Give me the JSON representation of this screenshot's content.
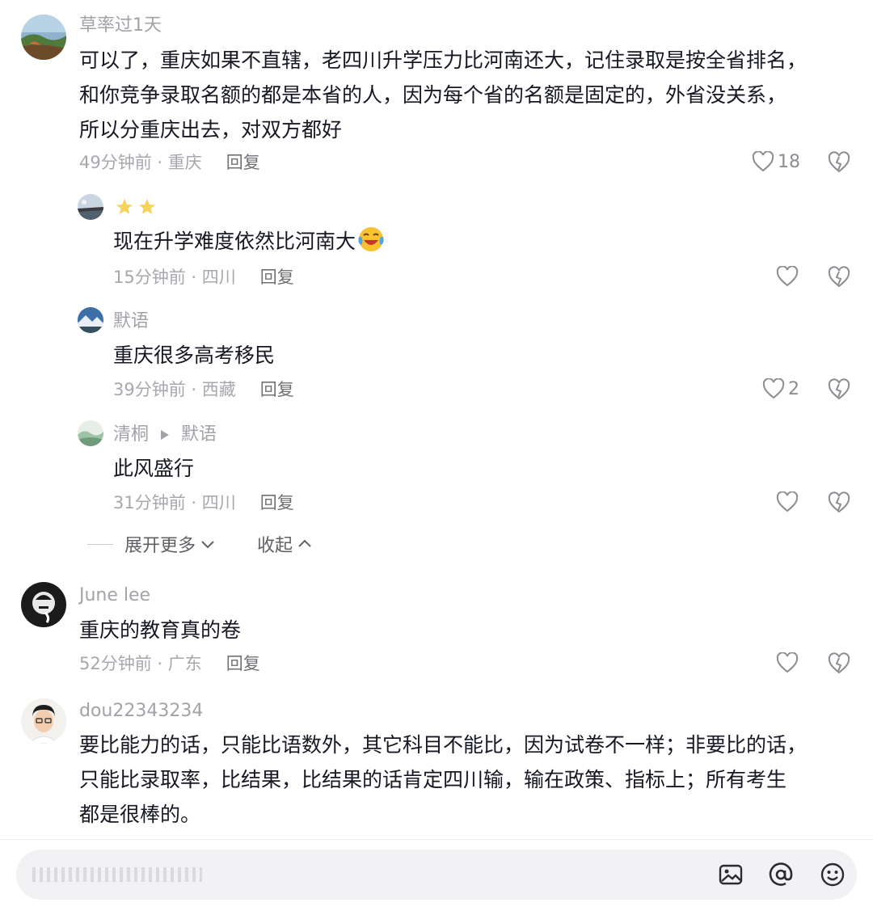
{
  "comments": [
    {
      "username": "草率过1天",
      "lines": [
        "可以了，重庆如果不直辖，老四川升学压力比河南还大，记住录取是按全省排名，",
        "和你竞争录取名额的都是本省的人，因为每个省的名额是固定的，外省没关系，",
        "所以分重庆出去，对双方都好"
      ],
      "time": "49分钟前 · 重庆",
      "reply_label": "回复",
      "like_count": "18"
    },
    {
      "username": "",
      "text": "现在升学难度依然比河南大",
      "time": "15分钟前 · 四川",
      "reply_label": "回复",
      "like_count": ""
    },
    {
      "username": "默语",
      "text": "重庆很多高考移民",
      "time": "39分钟前 · 西藏",
      "reply_label": "回复",
      "like_count": "2"
    },
    {
      "username": "清桐",
      "reply_to": "默语",
      "text": "此风盛行",
      "time": "31分钟前 · 四川",
      "reply_label": "回复",
      "like_count": ""
    },
    {
      "username": "June lee",
      "text": "重庆的教育真的卷",
      "time": "52分钟前 · 广东",
      "reply_label": "回复",
      "like_count": ""
    },
    {
      "username": "dou22343234",
      "lines": [
        "要比能力的话，只能比语数外，其它科目不能比，因为试卷不一样；非要比的话，",
        "只能比录取率，比结果，比结果的话肯定四川输，输在政策、指标上；所有考生",
        "都是很棒的。"
      ],
      "time": "",
      "reply_label": "",
      "like_count": ""
    }
  ],
  "thread_controls": {
    "expand_more": "展开更多",
    "collapse": "收起"
  },
  "colors": {
    "text_primary": "#161823",
    "text_secondary": "#a1a3a8",
    "input_bg": "#f2f2f4",
    "star": "#f7d35c"
  },
  "icons": [
    "heart-icon",
    "dislike-icon",
    "star-icon",
    "image-icon",
    "at-icon",
    "emoji-icon",
    "chevron-down-icon",
    "chevron-up-icon",
    "play-triangle-icon"
  ]
}
